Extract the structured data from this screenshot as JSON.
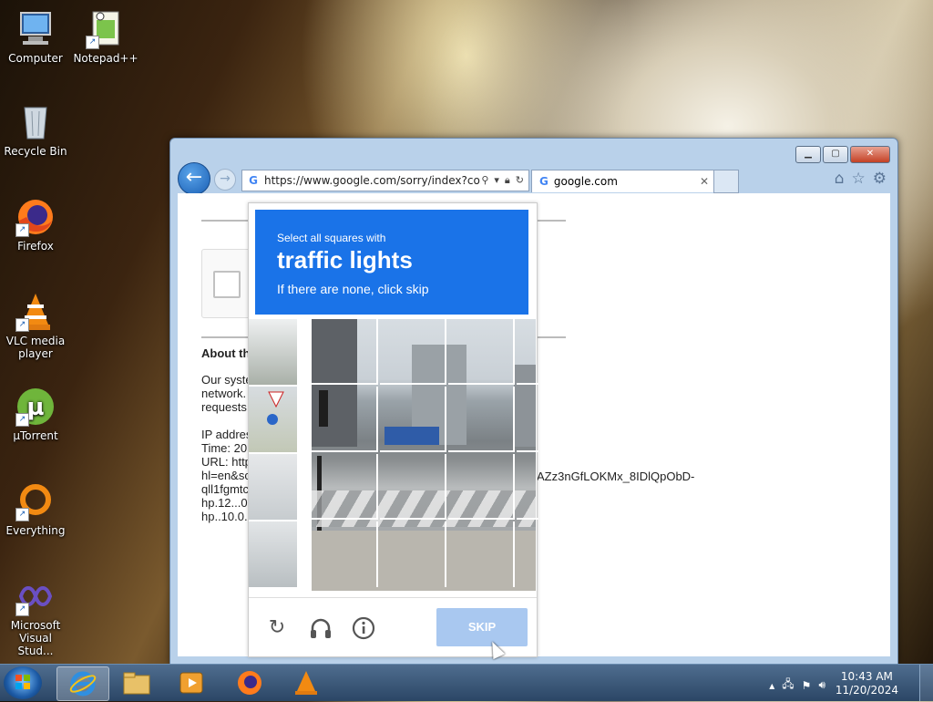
{
  "desktop": {
    "icons": [
      {
        "label": "Computer",
        "icon": "computer-icon"
      },
      {
        "label": "Notepad++",
        "icon": "notepadpp-icon"
      },
      {
        "label": "Recycle Bin",
        "icon": "recycle-bin-icon"
      },
      {
        "label": "Firefox",
        "icon": "firefox-icon"
      },
      {
        "label": "VLC media player",
        "icon": "vlc-icon"
      },
      {
        "label": "µTorrent",
        "icon": "utorrent-icon"
      },
      {
        "label": "Everything",
        "icon": "everything-icon"
      },
      {
        "label": "Microsoft Visual Stud...",
        "icon": "visual-studio-icon"
      }
    ]
  },
  "browser": {
    "address": {
      "url": "https://www.google.com/sorry/index?cor"
    },
    "tab": {
      "title": "google.com"
    },
    "page": {
      "heading": "About th",
      "paragraph": [
        "Our syste",
        "network.",
        "requests"
      ],
      "details": [
        "IP addres",
        "Time: 20",
        "URL: http",
        "hl=en&sc",
        "qll1fgmtc",
        "hp.12...0",
        "hp..10.0."
      ],
      "tail": "AZz3nGfLOKMx_8IDlQpObD-"
    }
  },
  "captcha": {
    "instruction_small": "Select all squares with",
    "target": "traffic lights",
    "instruction_sub": "If there are none, click skip",
    "skip_label": "SKIP"
  },
  "taskbar": {
    "time": "10:43 AM",
    "date": "11/20/2024"
  },
  "colors": {
    "accent": "#1a73e8",
    "skip": "#a9c8f0"
  }
}
